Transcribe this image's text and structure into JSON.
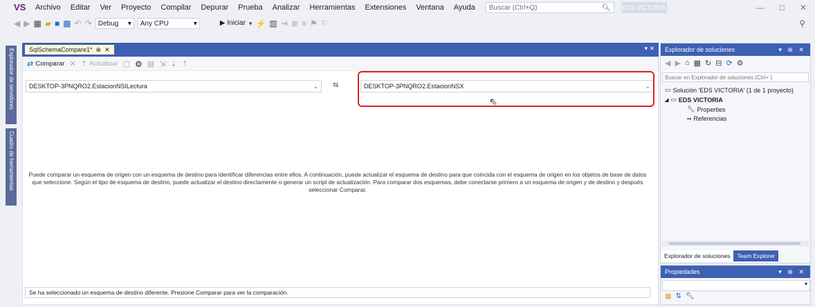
{
  "menubar": {
    "logo": "VS",
    "items": [
      "Archivo",
      "Editar",
      "Ver",
      "Proyecto",
      "Compilar",
      "Depurar",
      "Prueba",
      "Analizar",
      "Herramientas",
      "Extensiones",
      "Ventana",
      "Ayuda"
    ],
    "search_placeholder": "Buscar (Ctrl+Q)",
    "title": "EDS VICTORIA",
    "minimize": "—",
    "maximize": "□",
    "close": "✕"
  },
  "toolbar": {
    "config": "Debug",
    "platform": "Any CPU",
    "start": "▶ Iniciar"
  },
  "left_strip": {
    "tab1": "Explorador de servidores",
    "tab2": "Cuadro de herramientas"
  },
  "document": {
    "tab_title": "SqlSchemaCompare1*",
    "tab_pin": "⊕",
    "tab_close": "✕",
    "tab_row_controls": "▾ ✕",
    "toolbar": {
      "compare": "Comparar",
      "update": "Actualizar"
    },
    "source_schema": "DESKTOP-3PNQRO2.EstacionNSILectura",
    "swap": "⇆",
    "target_schema": "DESKTOP-3PNQRO2.EstacionNSX",
    "description": "Puede comparar un esquema de origen con un esquema de destino para identificar diferencias entre ellos. A continuación, puede actualizar el esquema de destino para que coincida con el esquema de origen en los objetos de base de datos que seleccione. Según el tipo de esquema de destino, puede actualizar el destino directamente o generar un script de actualización. Para comparar dos esquemas, debe conectarse primero a un esquema de origen y de destino y después seleccionar Comparar.",
    "status": "Se ha seleccionado un esquema de destino diferente. Presione Comparar para ver la comparación."
  },
  "solution_explorer": {
    "title": "Explorador de soluciones",
    "title_controls": "▾ ⊕ ✕",
    "search_placeholder": "Buscar en Explorador de soluciones (Ctrl+`)",
    "solution": "Solución 'EDS VICTORIA' (1 de 1 proyecto)",
    "project": "EDS VICTORIA",
    "properties": "Properties",
    "references": "Referencias",
    "tab_active": "Explorador de soluciones",
    "tab_inactive": "Team Explorer"
  },
  "properties_panel": {
    "title": "Propiedades",
    "title_controls": "▾ ⊕ ✕"
  },
  "colors": {
    "accent_blue": "#3e60b2",
    "highlight_red": "#e01e24",
    "tab_yellow": "#fcf7da"
  }
}
